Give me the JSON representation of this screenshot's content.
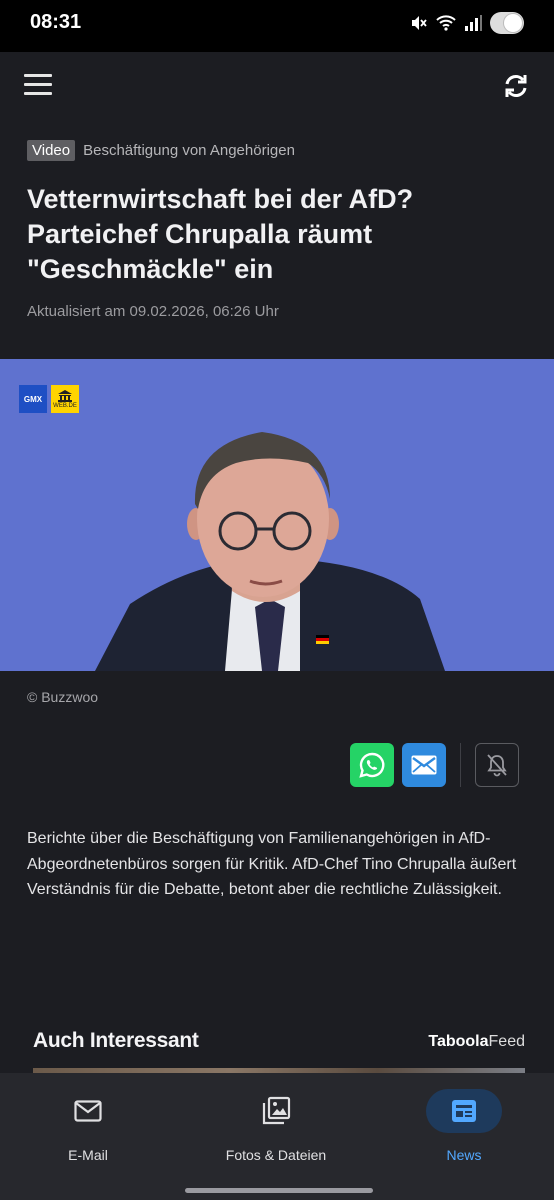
{
  "status_bar": {
    "time": "08:31"
  },
  "article": {
    "badge": "Video",
    "category": "Beschäftigung von Angehörigen",
    "headline": "Vetternwirtschaft bei der AfD? Parteichef Chrupalla räumt \"Geschmäckle\" ein",
    "updated": "Aktualisiert am 09.02.2026, 06:26 Uhr",
    "image_credit": "© Buzzwoo",
    "image_logos": {
      "gmx": "GMX",
      "webde": "WEB.DE"
    },
    "teaser": "Berichte über die Beschäftigung von Familienangehörigen in AfD-Abgeordnetenbüros sorgen für Kritik. AfD-Chef Tino Chrupalla äußert Verständnis für die Debatte, betont aber die rechtliche Zulässigkeit."
  },
  "share": {
    "icons": [
      "whatsapp-icon",
      "mail-icon",
      "notification-off-icon"
    ]
  },
  "recommendations": {
    "title": "Auch Interessant",
    "provider_bold": "Taboola",
    "provider_light": "Feed"
  },
  "bottom_nav": {
    "items": [
      {
        "label": "E-Mail",
        "icon": "mail-icon",
        "active": false
      },
      {
        "label": "Fotos & Dateien",
        "icon": "photos-icon",
        "active": false
      },
      {
        "label": "News",
        "icon": "news-icon",
        "active": true
      }
    ]
  },
  "colors": {
    "background": "#1c1d22",
    "accent": "#52a8ff",
    "whatsapp": "#25d366",
    "mail": "#2f8ade",
    "hero_background": "#5f72cf"
  }
}
